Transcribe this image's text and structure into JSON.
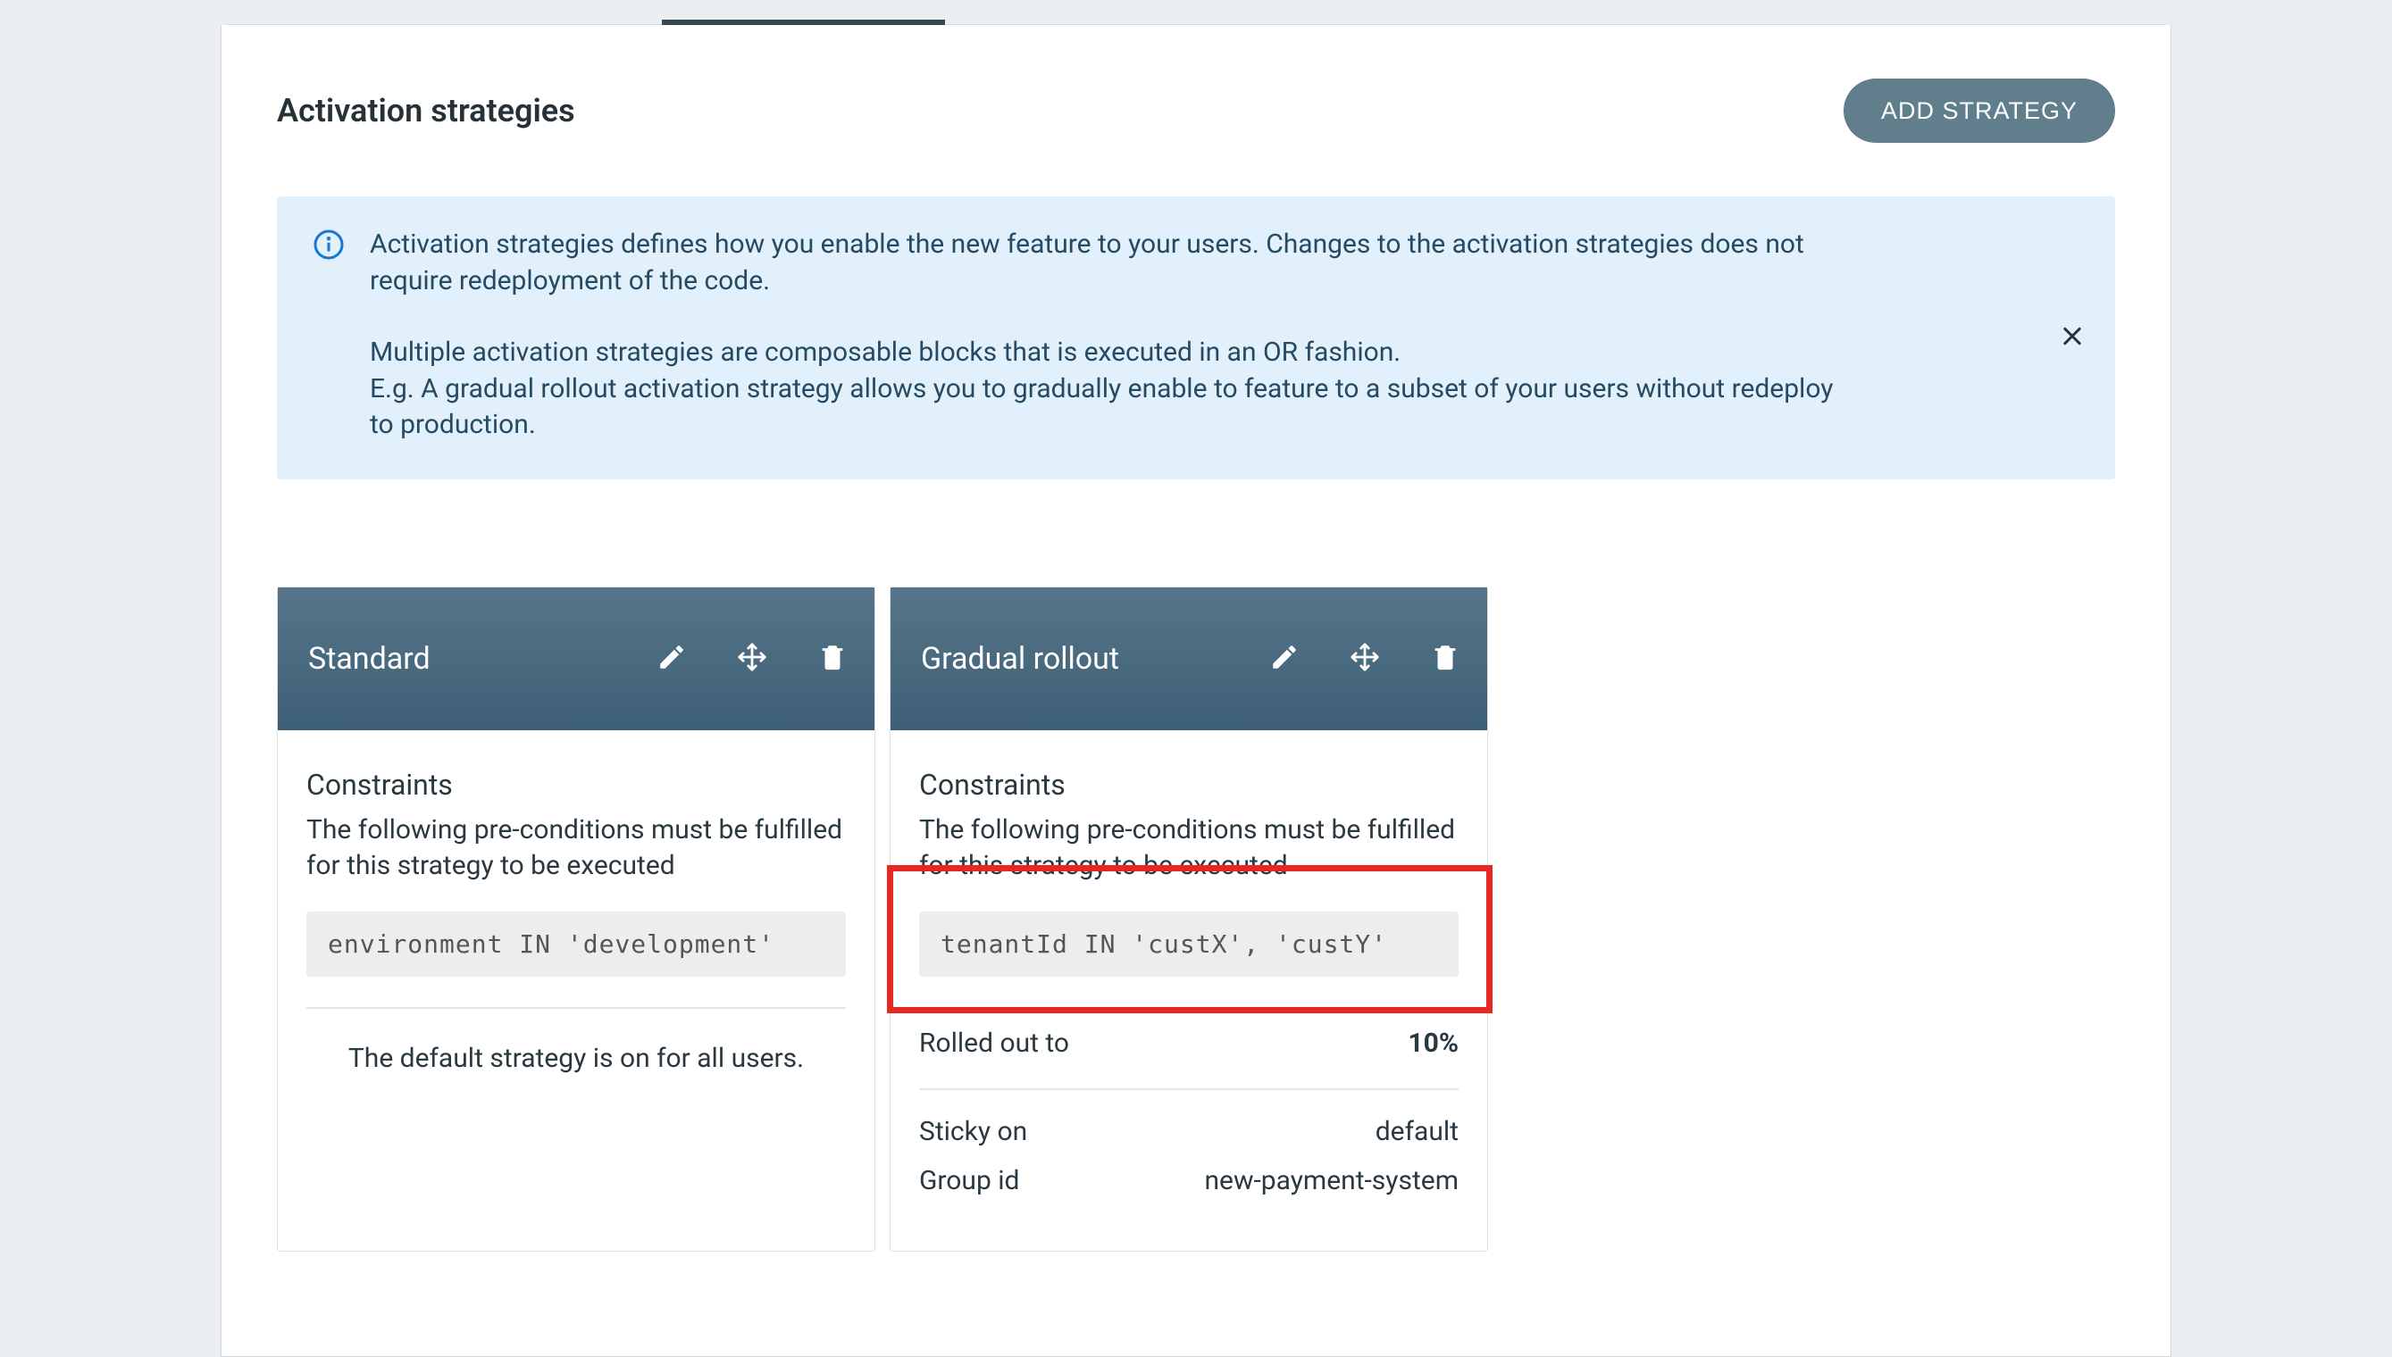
{
  "section_title": "Activation strategies",
  "add_button_label": "ADD STRATEGY",
  "info_banner": {
    "paragraph1": "Activation strategies defines how you enable the new feature to your users. Changes to the activation strategies does not require redeployment of the code.",
    "paragraph2": "Multiple activation strategies are composable blocks that is executed in an OR fashion.\nE.g. A gradual rollout activation strategy allows you to gradually enable to feature to a subset of your users without redeploy to production."
  },
  "cards": [
    {
      "title": "Standard",
      "constraints_heading": "Constraints",
      "constraints_desc": "The following pre-conditions must be fulfilled for this strategy to be executed",
      "constraint_expression": "environment IN 'development'",
      "footer_text": "The default strategy is on for all users."
    },
    {
      "title": "Gradual rollout",
      "constraints_heading": "Constraints",
      "constraints_desc": "The following pre-conditions must be fulfilled for this strategy to be executed",
      "constraint_expression": "tenantId IN 'custX', 'custY'",
      "rows": {
        "rolled_out_label": "Rolled out to",
        "rolled_out_value": "10%",
        "sticky_label": "Sticky on",
        "sticky_value": "default",
        "group_label": "Group id",
        "group_value": "new-payment-system"
      }
    }
  ]
}
